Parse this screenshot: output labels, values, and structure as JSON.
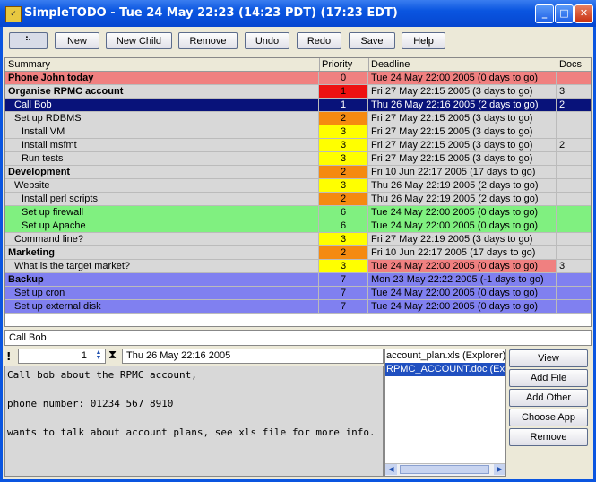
{
  "window": {
    "title": "SimpleTODO - Tue 24 May 22:23  (14:23 PDT)  (17:23 EDT)"
  },
  "toolbar": {
    "buttons": [
      "New",
      "New Child",
      "Remove",
      "Undo",
      "Redo",
      "Save",
      "Help"
    ]
  },
  "table": {
    "columns": [
      "Summary",
      "Priority",
      "Deadline",
      "Docs"
    ],
    "rows": [
      {
        "summary": "Phone John today",
        "priority": "0",
        "deadline": "Tue 24 May 22:00 2005 (0 days to go)",
        "docs": "",
        "bold": true,
        "indent": 0,
        "row_color": "#f08080",
        "prio_color": "#f08080",
        "dl_color": "#f08080"
      },
      {
        "summary": "Organise RPMC account",
        "priority": "1",
        "deadline": "Fri 27 May 22:15 2005 (3 days to go)",
        "docs": "3",
        "bold": true,
        "indent": 0,
        "row_color": "#d8d8d8",
        "prio_color": "#ee1111",
        "dl_color": "#d8d8d8"
      },
      {
        "summary": "Call Bob",
        "priority": "1",
        "deadline": "Thu 26 May 22:16 2005 (2 days to go)",
        "docs": "2",
        "bold": false,
        "indent": 1,
        "row_color": "#08127a",
        "prio_color": "#08127a",
        "dl_color": "#08127a",
        "selected": true
      },
      {
        "summary": "Set up RDBMS",
        "priority": "2",
        "deadline": "Fri 27 May 22:15 2005 (3 days to go)",
        "docs": "",
        "bold": false,
        "indent": 1,
        "row_color": "#d8d8d8",
        "prio_color": "#f58a10",
        "dl_color": "#d8d8d8"
      },
      {
        "summary": "Install VM",
        "priority": "3",
        "deadline": "Fri 27 May 22:15 2005 (3 days to go)",
        "docs": "",
        "bold": false,
        "indent": 2,
        "row_color": "#d8d8d8",
        "prio_color": "#ffff00",
        "dl_color": "#d8d8d8"
      },
      {
        "summary": "Install msfmt",
        "priority": "3",
        "deadline": "Fri 27 May 22:15 2005 (3 days to go)",
        "docs": "2",
        "bold": false,
        "indent": 2,
        "row_color": "#d8d8d8",
        "prio_color": "#ffff00",
        "dl_color": "#d8d8d8"
      },
      {
        "summary": "Run tests",
        "priority": "3",
        "deadline": "Fri 27 May 22:15 2005 (3 days to go)",
        "docs": "",
        "bold": false,
        "indent": 2,
        "row_color": "#d8d8d8",
        "prio_color": "#ffff00",
        "dl_color": "#d8d8d8"
      },
      {
        "summary": "Development",
        "priority": "2",
        "deadline": "Fri 10 Jun 22:17 2005 (17 days to go)",
        "docs": "",
        "bold": true,
        "indent": 0,
        "row_color": "#d8d8d8",
        "prio_color": "#f58a10",
        "dl_color": "#d8d8d8"
      },
      {
        "summary": "Website",
        "priority": "3",
        "deadline": "Thu 26 May 22:19 2005 (2 days to go)",
        "docs": "",
        "bold": false,
        "indent": 1,
        "row_color": "#d8d8d8",
        "prio_color": "#ffff00",
        "dl_color": "#d8d8d8"
      },
      {
        "summary": "Install perl scripts",
        "priority": "2",
        "deadline": "Thu 26 May 22:19 2005 (2 days to go)",
        "docs": "",
        "bold": false,
        "indent": 2,
        "row_color": "#d8d8d8",
        "prio_color": "#f58a10",
        "dl_color": "#d8d8d8"
      },
      {
        "summary": "Set up firewall",
        "priority": "6",
        "deadline": "Tue 24 May 22:00 2005 (0 days to go)",
        "docs": "",
        "bold": false,
        "indent": 2,
        "row_color": "#80f080",
        "prio_color": "#80f080",
        "dl_color": "#80f080"
      },
      {
        "summary": "Set up Apache",
        "priority": "6",
        "deadline": "Tue 24 May 22:00 2005 (0 days to go)",
        "docs": "",
        "bold": false,
        "indent": 2,
        "row_color": "#80f080",
        "prio_color": "#80f080",
        "dl_color": "#80f080"
      },
      {
        "summary": "Command line?",
        "priority": "3",
        "deadline": "Fri 27 May 22:19 2005 (3 days to go)",
        "docs": "",
        "bold": false,
        "indent": 1,
        "row_color": "#d8d8d8",
        "prio_color": "#ffff00",
        "dl_color": "#d8d8d8"
      },
      {
        "summary": "Marketing",
        "priority": "2",
        "deadline": "Fri 10 Jun 22:17 2005 (17 days to go)",
        "docs": "",
        "bold": true,
        "indent": 0,
        "row_color": "#d8d8d8",
        "prio_color": "#f58a10",
        "dl_color": "#d8d8d8"
      },
      {
        "summary": "What is the target market?",
        "priority": "3",
        "deadline": "Tue 24 May 22:00 2005 (0 days to go)",
        "docs": "3",
        "bold": false,
        "indent": 1,
        "row_color": "#d8d8d8",
        "prio_color": "#ffff00",
        "dl_color": "#f08080"
      },
      {
        "summary": "Backup",
        "priority": "7",
        "deadline": "Mon 23 May 22:22 2005 (-1 days to go)",
        "docs": "",
        "bold": true,
        "indent": 0,
        "row_color": "#8080f0",
        "prio_color": "#8080f0",
        "dl_color": "#8080f0"
      },
      {
        "summary": "Set up cron",
        "priority": "7",
        "deadline": "Tue 24 May 22:00 2005 (0 days to go)",
        "docs": "",
        "bold": false,
        "indent": 1,
        "row_color": "#8080f0",
        "prio_color": "#8080f0",
        "dl_color": "#8080f0"
      },
      {
        "summary": "Set up external disk",
        "priority": "7",
        "deadline": "Tue 24 May 22:00 2005 (0 days to go)",
        "docs": "",
        "bold": false,
        "indent": 1,
        "row_color": "#8080f0",
        "prio_color": "#8080f0",
        "dl_color": "#8080f0"
      }
    ]
  },
  "detail": {
    "title": "Call Bob",
    "priority_value": "1",
    "deadline": "Thu 26 May 22:16 2005",
    "notes": "Call bob about the RPMC account,\n\nphone number: 01234 567 8910\n\nwants to talk about account plans, see xls file for more info."
  },
  "files": {
    "items": [
      {
        "name": "account_plan.xls (Explorer)",
        "selected": false
      },
      {
        "name": "RPMC_ACCOUNT.doc (Explorer)",
        "selected": true
      }
    ]
  },
  "side_buttons": [
    "View",
    "Add File",
    "Add Other",
    "Choose App",
    "Remove"
  ]
}
